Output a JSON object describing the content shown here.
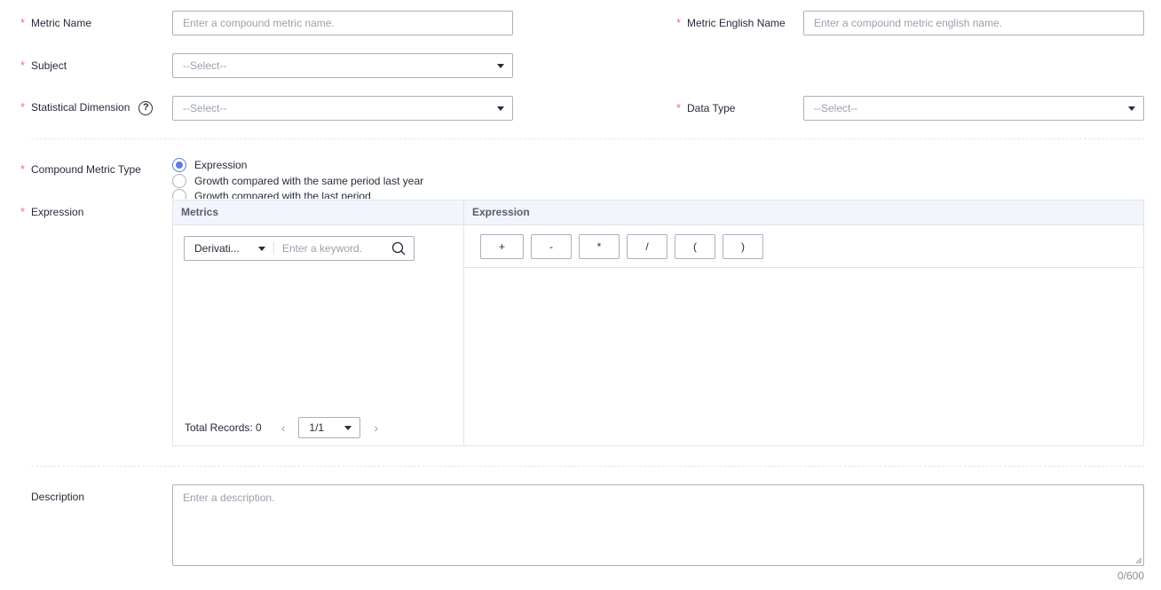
{
  "form": {
    "metric_name": {
      "label": "Metric Name",
      "placeholder": "Enter a compound metric name."
    },
    "metric_english_name": {
      "label": "Metric English Name",
      "placeholder": "Enter a compound metric english name."
    },
    "subject": {
      "label": "Subject",
      "value": "--Select--"
    },
    "statistical_dimension": {
      "label": "Statistical Dimension",
      "value": "--Select--",
      "help_icon": "?"
    },
    "data_type": {
      "label": "Data Type",
      "value": "--Select--"
    },
    "compound_metric_type": {
      "label": "Compound Metric Type",
      "options": [
        "Expression",
        "Growth compared with the same period last year",
        "Growth compared with the last period"
      ],
      "selected": "Expression"
    },
    "expression": {
      "label": "Expression",
      "metrics_header": "Metrics",
      "expression_header": "Expression",
      "metric_kind": "Derivati...",
      "keyword_placeholder": "Enter a keyword.",
      "total_records": "Total Records: 0",
      "page": "1/1",
      "operators": [
        "+",
        "-",
        "*",
        "/",
        "(",
        ")"
      ]
    },
    "description": {
      "label": "Description",
      "placeholder": "Enter a description.",
      "counter": "0/600"
    }
  },
  "colors": {
    "required": "#f66f6a",
    "accent": "#5e7ce0",
    "border": "#adb0b8",
    "header_bg": "#f2f5fc"
  },
  "icons": [
    "required-asterisk",
    "help-icon",
    "chevron-down-icon",
    "search-icon",
    "chevron-left-icon",
    "chevron-right-icon",
    "resize-handle-icon"
  ]
}
